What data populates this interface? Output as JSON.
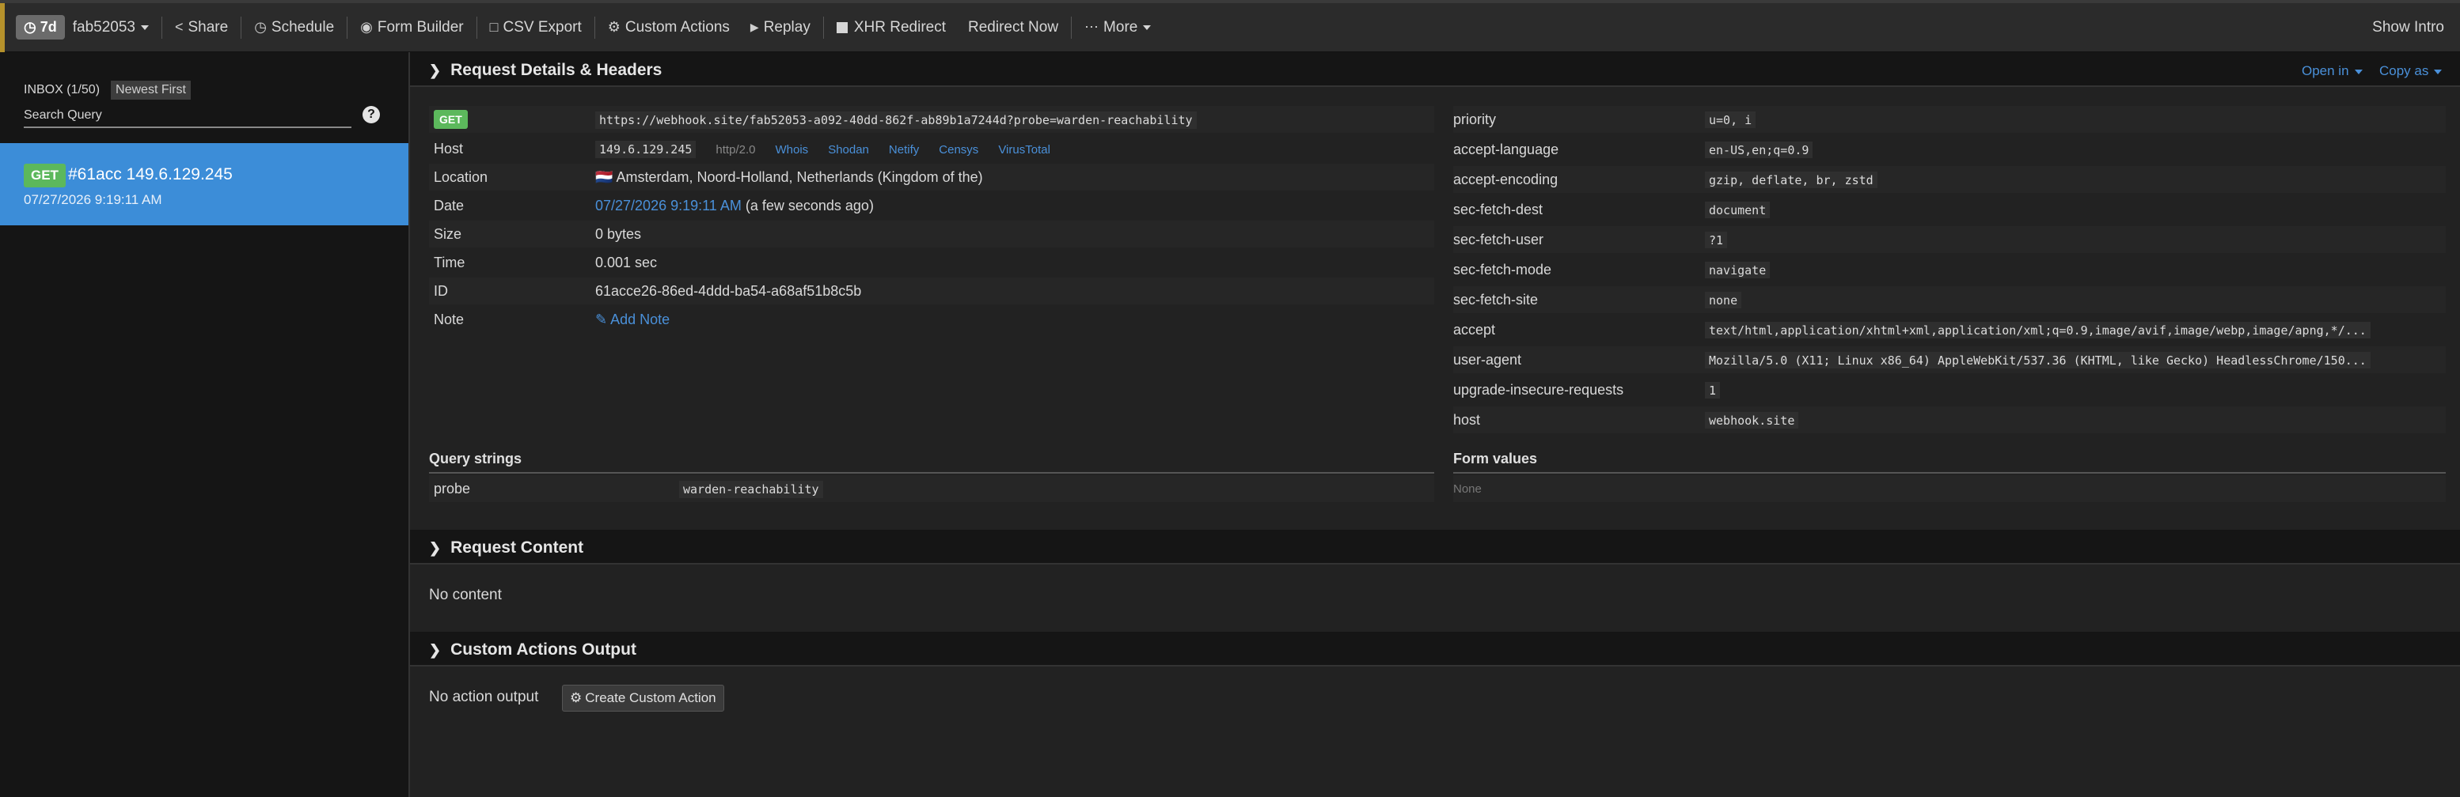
{
  "topbar": {
    "expiry_badge": "7d",
    "token": "fab52053",
    "share": "Share",
    "schedule": "Schedule",
    "form_builder": "Form Builder",
    "csv_export": "CSV Export",
    "custom_actions": "Custom Actions",
    "replay": "Replay",
    "xhr_redirect": "XHR Redirect",
    "redirect_now": "Redirect Now",
    "more": "More",
    "show_intro": "Show Intro"
  },
  "sidebar": {
    "inbox_label": "INBOX (1/50)",
    "sort_label": "Newest First",
    "search_placeholder": "Search Query",
    "help_icon": "?",
    "requests": [
      {
        "method": "GET",
        "title": "#61acc 149.6.129.245",
        "date": "07/27/2026 9:19:11 AM"
      }
    ]
  },
  "details": {
    "section_title": "Request Details & Headers",
    "open_in": "Open in",
    "copy_as": "Copy as",
    "method": "GET",
    "url": "https://webhook.site/fab52053-a092-40dd-862f-ab89b1a7244d?probe=warden-reachability",
    "host_label": "Host",
    "host_ip": "149.6.129.245",
    "protocol": "http/2.0",
    "host_links": [
      "Whois",
      "Shodan",
      "Netify",
      "Censys",
      "VirusTotal"
    ],
    "location_label": "Location",
    "location_flag": "🇳🇱",
    "location": "Amsterdam, Noord-Holland, Netherlands (Kingdom of the)",
    "date_label": "Date",
    "date": "07/27/2026 9:19:11 AM",
    "date_relative": "(a few seconds ago)",
    "size_label": "Size",
    "size": "0 bytes",
    "time_label": "Time",
    "time": "0.001 sec",
    "id_label": "ID",
    "id": "61acce26-86ed-4ddd-ba54-a68af51b8c5b",
    "note_label": "Note",
    "add_note": "Add Note",
    "headers": [
      {
        "name": "priority",
        "value": "u=0, i"
      },
      {
        "name": "accept-language",
        "value": "en-US,en;q=0.9"
      },
      {
        "name": "accept-encoding",
        "value": "gzip, deflate, br, zstd"
      },
      {
        "name": "sec-fetch-dest",
        "value": "document"
      },
      {
        "name": "sec-fetch-user",
        "value": "?1"
      },
      {
        "name": "sec-fetch-mode",
        "value": "navigate"
      },
      {
        "name": "sec-fetch-site",
        "value": "none"
      },
      {
        "name": "accept",
        "value": "text/html,application/xhtml+xml,application/xml;q=0.9,image/avif,image/webp,image/apng,*/..."
      },
      {
        "name": "user-agent",
        "value": "Mozilla/5.0 (X11; Linux x86_64) AppleWebKit/537.36 (KHTML, like Gecko) HeadlessChrome/150..."
      },
      {
        "name": "upgrade-insecure-requests",
        "value": "1"
      },
      {
        "name": "host",
        "value": "webhook.site"
      }
    ],
    "query_strings_title": "Query strings",
    "query_strings": [
      {
        "name": "probe",
        "value": "warden-reachability"
      }
    ],
    "form_values_title": "Form values",
    "form_values_empty": "None"
  },
  "content": {
    "section_title": "Request Content",
    "empty": "No content"
  },
  "custom_actions_output": {
    "section_title": "Custom Actions Output",
    "empty": "No action output",
    "create_button": "Create Custom Action"
  },
  "colors": {
    "accent_blue": "#4a90d9",
    "selected_item": "#3c8dd8",
    "get_badge": "#5cb85c"
  }
}
